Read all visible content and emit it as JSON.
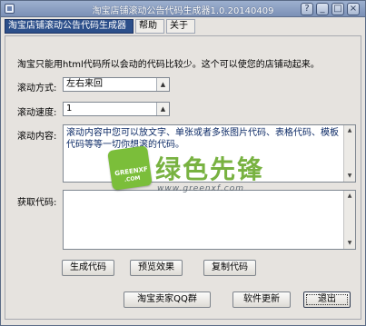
{
  "window": {
    "title": "淘宝店铺滚动公告代码生成器1.0.20140409"
  },
  "title_buttons": [
    "?",
    "_",
    "□",
    "×"
  ],
  "menu": [
    "淘宝店铺滚动公告代码生成器",
    "帮助",
    "关于"
  ],
  "intro": "淘宝只能用html代码所以会动的代码比较少。这个可以使您的店铺动起来。",
  "scroll_direction": {
    "label": "滚动方式:",
    "value": "左右来回"
  },
  "scroll_speed": {
    "label": "滚动速度:",
    "value": "1"
  },
  "content": {
    "label": "滚动内容:",
    "value": "滚动内容中您可以放文字、单张或者多张图片代码、表格代码、模板代码等等一切你想滚的代码。"
  },
  "output": {
    "label": "获取代码:",
    "value": ""
  },
  "actions": {
    "generate": "生成代码",
    "preview": "预览效果",
    "copy": "复制代码"
  },
  "footer": {
    "qq_group": "淘宝卖家QQ群",
    "update": "软件更新",
    "exit": "退出"
  },
  "watermark": {
    "logo_line1": "GREENXF",
    "logo_line2": ".COM",
    "big": "绿色先锋",
    "url": "www.greenxf.com"
  },
  "colors": {
    "accent": "#2c4f8a",
    "titlebar": "#8ca0c4",
    "watermark_green": "#6aaa2d"
  }
}
